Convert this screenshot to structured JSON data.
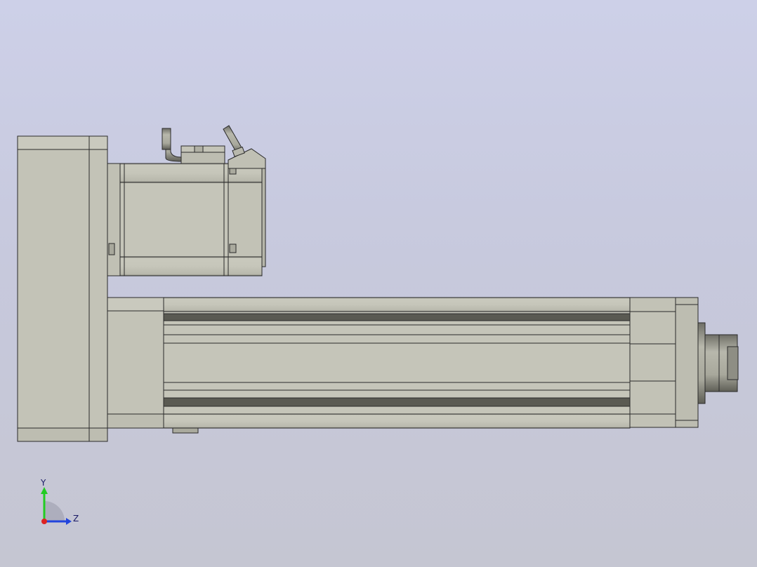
{
  "viewport": {
    "background_top": "#cdd0e8",
    "background_bottom": "#c5c6d2"
  },
  "model": {
    "body_color": "#c4c4b8",
    "edge_color": "#2a2a2a",
    "shade_color": "#9c9c90"
  },
  "triad": {
    "y_label": "Y",
    "z_label": "Z",
    "y_color": "#22cc22",
    "z_color": "#2244dd",
    "x_color": "#dd2222"
  }
}
